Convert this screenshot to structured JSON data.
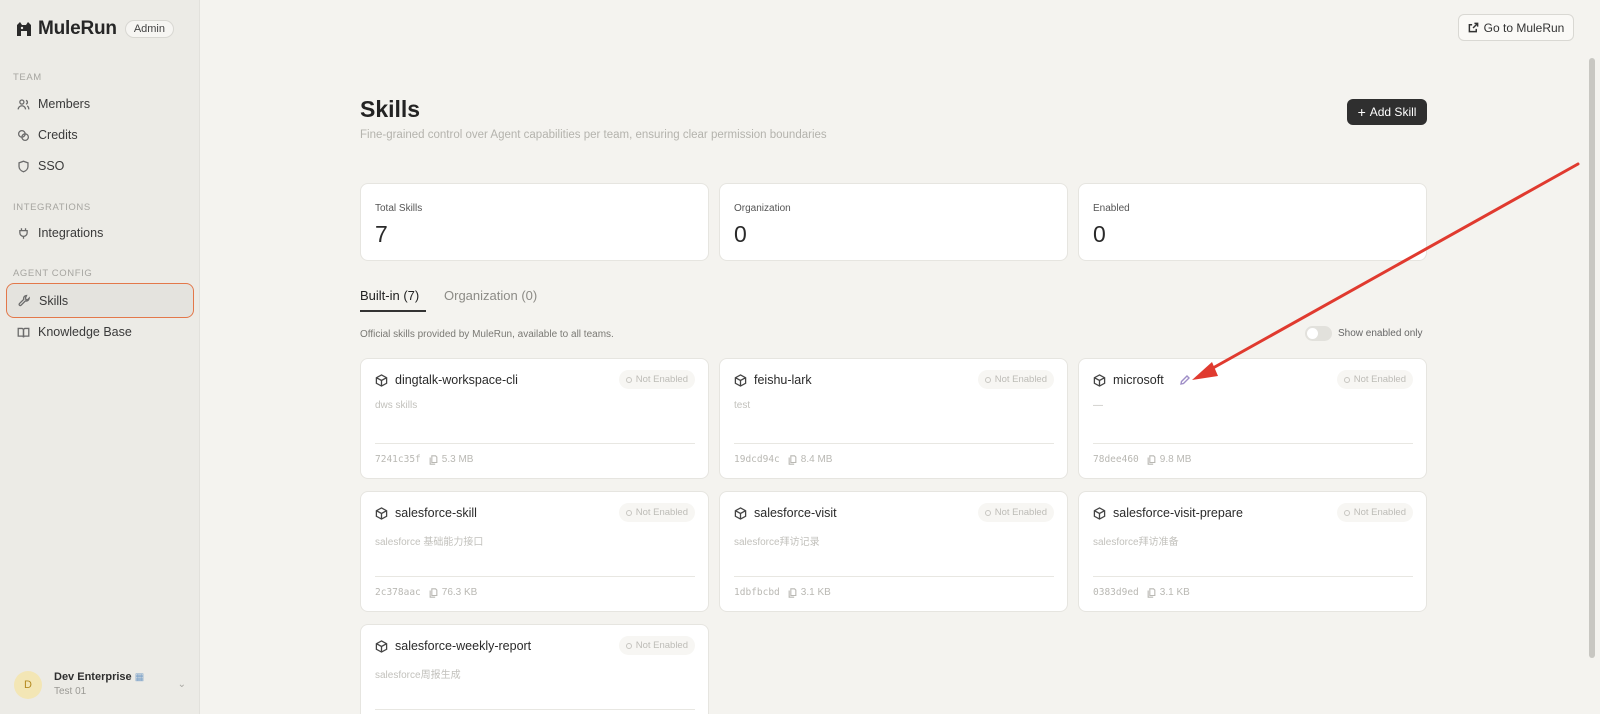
{
  "sidebar": {
    "brand": "MuleRun",
    "badge": "Admin",
    "sections": {
      "team": "TEAM",
      "integrations": "INTEGRATIONS",
      "agent_config": "AGENT CONFIG"
    },
    "items": {
      "members": "Members",
      "credits": "Credits",
      "sso": "SSO",
      "integrations": "Integrations",
      "skills": "Skills",
      "knowledge_base": "Knowledge Base"
    },
    "active_item": "skills",
    "user": {
      "initial": "D",
      "name": "Dev Enterprise",
      "sub": "Test 01"
    }
  },
  "header": {
    "goto_label": "Go to MuleRun"
  },
  "main": {
    "title": "Skills",
    "subtitle": "Fine-grained control over Agent capabilities per team, ensuring clear permission boundaries",
    "add_button": "Add Skill",
    "stats": {
      "total": {
        "label": "Total Skills",
        "value": "7"
      },
      "organization": {
        "label": "Organization",
        "value": "0"
      },
      "enabled": {
        "label": "Enabled",
        "value": "0"
      }
    },
    "tabs": {
      "builtin": "Built-in (7)",
      "organization": "Organization (0)"
    },
    "description": "Official skills provided by MuleRun, available to all teams.",
    "toggle_label": "Show enabled only",
    "skills": [
      {
        "name": "dingtalk-workspace-cli",
        "desc": "dws skills",
        "hash": "7241c35f",
        "size": "5.3 MB",
        "status": "Not Enabled"
      },
      {
        "name": "feishu-lark",
        "desc": "test",
        "hash": "19dcd94c",
        "size": "8.4 MB",
        "status": "Not Enabled"
      },
      {
        "name": "microsoft",
        "desc": "—",
        "hash": "78dee460",
        "size": "9.8 MB",
        "status": "Not Enabled"
      },
      {
        "name": "salesforce-skill",
        "desc": "salesforce 基础能力接口",
        "hash": "2c378aac",
        "size": "76.3 KB",
        "status": "Not Enabled"
      },
      {
        "name": "salesforce-visit",
        "desc": "salesforce拜访记录",
        "hash": "1dbfbcbd",
        "size": "3.1 KB",
        "status": "Not Enabled"
      },
      {
        "name": "salesforce-visit-prepare",
        "desc": "salesforce拜访准备",
        "hash": "0383d9ed",
        "size": "3.1 KB",
        "status": "Not Enabled"
      },
      {
        "name": "salesforce-weekly-report",
        "desc": "salesforce周报生成",
        "hash": "",
        "size": "",
        "status": "Not Enabled"
      }
    ]
  },
  "colors": {
    "accent_outline": "#e3784a",
    "annotation_arrow": "#e03a2f",
    "primary_button": "#2f2f2f"
  }
}
